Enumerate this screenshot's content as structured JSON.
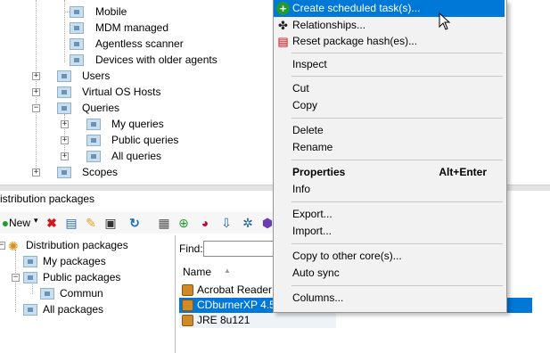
{
  "top_tree": {
    "items": [
      {
        "label": "Mobile"
      },
      {
        "label": "MDM managed"
      },
      {
        "label": "Agentless scanner"
      },
      {
        "label": "Devices with older agents"
      },
      {
        "label": "Users"
      },
      {
        "label": "Virtual OS Hosts"
      },
      {
        "label": "Queries"
      },
      {
        "label": "My queries"
      },
      {
        "label": "Public queries"
      },
      {
        "label": "All queries"
      },
      {
        "label": "Scopes"
      }
    ]
  },
  "panel": {
    "title": "istribution packages",
    "toolbar": {
      "new_label": "New"
    },
    "tree": [
      {
        "label": "Distribution packages"
      },
      {
        "label": "My packages"
      },
      {
        "label": "Public packages"
      },
      {
        "label": "Commun"
      },
      {
        "label": "All packages"
      }
    ],
    "find_label": "Find:",
    "column_name": "Name",
    "packages": [
      {
        "label": "Acrobat ReaderM"
      },
      {
        "label": "CDburnerXP 4.5.7"
      },
      {
        "label": "JRE 8u121"
      }
    ]
  },
  "context_menu": {
    "items": [
      {
        "label": "Create scheduled task(s)...",
        "icon": "clock-add-icon"
      },
      {
        "label": "Relationships...",
        "icon": "relationships-icon"
      },
      {
        "label": "Reset package hash(es)...",
        "icon": "reset-hash-icon"
      },
      {
        "label": "Inspect"
      },
      {
        "label": "Cut"
      },
      {
        "label": "Copy"
      },
      {
        "label": "Delete"
      },
      {
        "label": "Rename"
      },
      {
        "label": "Properties",
        "shortcut": "Alt+Enter"
      },
      {
        "label": "Info"
      },
      {
        "label": "Export..."
      },
      {
        "label": "Import..."
      },
      {
        "label": "Copy to other core(s)..."
      },
      {
        "label": "Auto sync"
      },
      {
        "label": "Columns..."
      }
    ]
  },
  "colors": {
    "selection": "#0078d7",
    "menu_bg": "#f2f2f2"
  }
}
